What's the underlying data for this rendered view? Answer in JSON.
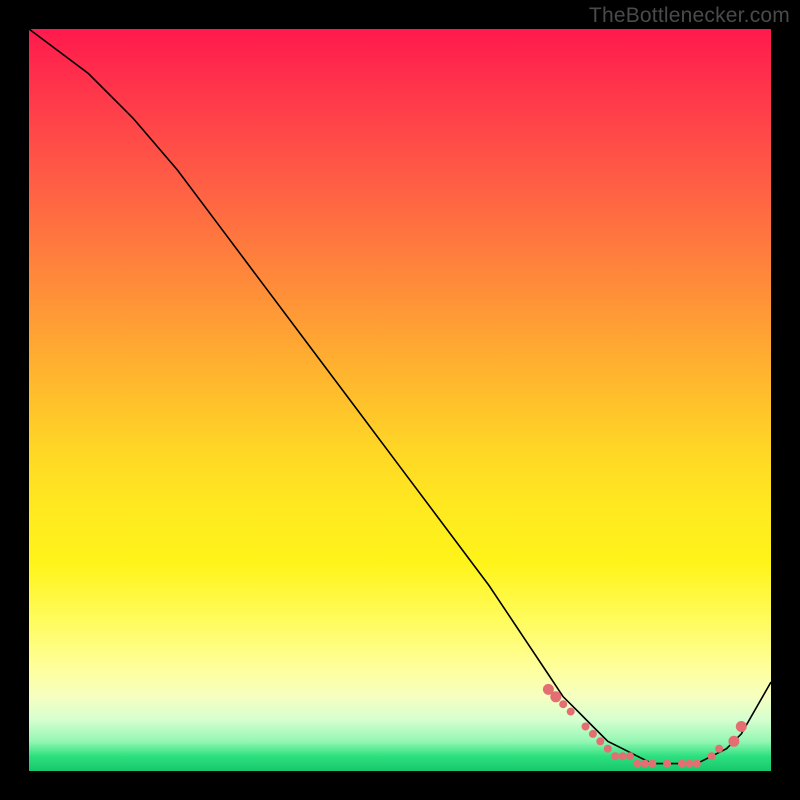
{
  "watermark": "TheBottlenecker.com",
  "colors": {
    "point": "#e36f73",
    "line": "#000000"
  },
  "chart_data": {
    "type": "line",
    "title": "",
    "xlabel": "",
    "ylabel": "",
    "xlim": [
      0,
      100
    ],
    "ylim": [
      0,
      100
    ],
    "series": [
      {
        "name": "curve",
        "x": [
          0,
          8,
          14,
          20,
          26,
          32,
          38,
          44,
          50,
          56,
          62,
          66,
          70,
          72,
          74,
          76,
          78,
          80,
          82,
          84,
          86,
          88,
          90,
          92,
          94,
          96,
          100
        ],
        "y": [
          100,
          94,
          88,
          81,
          73,
          65,
          57,
          49,
          41,
          33,
          25,
          19,
          13,
          10,
          8,
          6,
          4,
          3,
          2,
          1,
          1,
          1,
          1,
          2,
          3,
          5,
          12
        ]
      }
    ],
    "points": {
      "name": "markers",
      "x": [
        70,
        71,
        72,
        73,
        75,
        76,
        77,
        78,
        79,
        80,
        81,
        82,
        83,
        84,
        86,
        88,
        89,
        90,
        92,
        93,
        95,
        96
      ],
      "y": [
        11,
        10,
        9,
        8,
        6,
        5,
        4,
        3,
        2,
        2,
        2,
        1,
        1,
        1,
        1,
        1,
        1,
        1,
        2,
        3,
        4,
        6
      ],
      "radius_big_idx": [
        0,
        1,
        20,
        21
      ],
      "radius_big": 5.5,
      "radius_small": 4
    }
  }
}
